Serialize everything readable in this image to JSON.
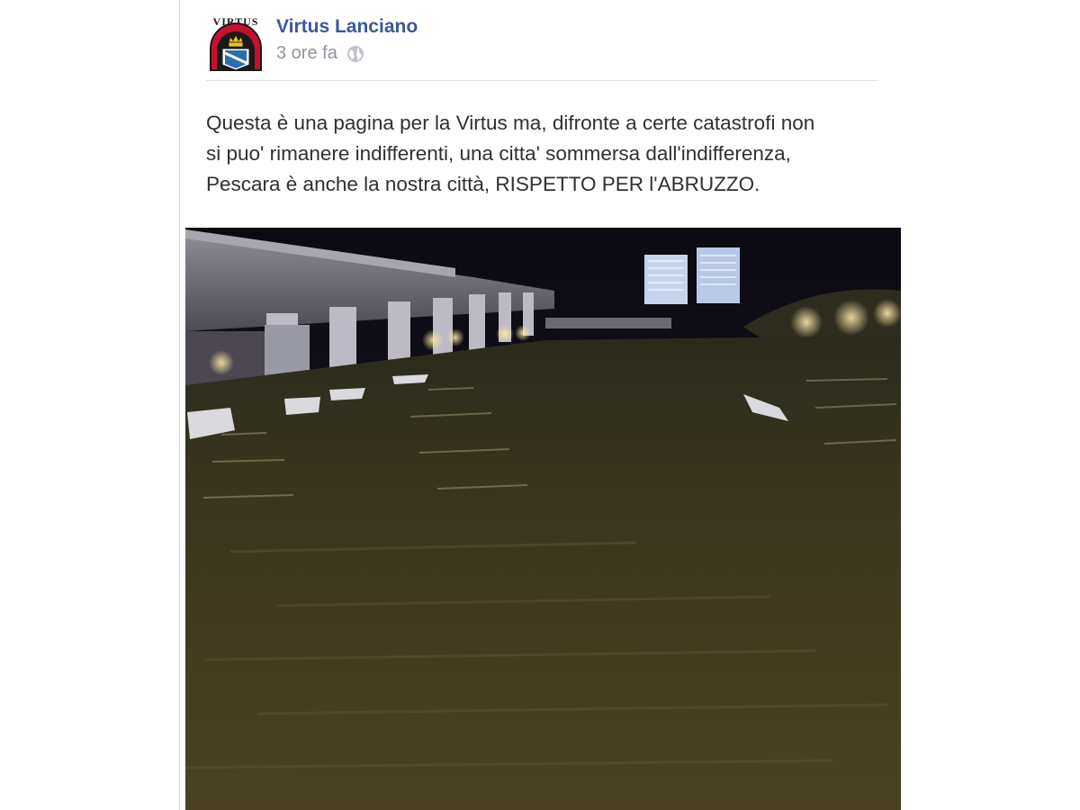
{
  "post": {
    "page_name": "Virtus Lanciano",
    "timestamp": "3 ore fa",
    "privacy_icon": "globe-icon",
    "text_lines": [
      "Questa è una pagina per la Virtus ma, difronte a certe catastrofi non",
      "si puo' rimanere indifferenti, una citta' sommersa dall'indifferenza,",
      "Pescara è anche la nostra città, RISPETTO PER l'ABRUZZO."
    ],
    "avatar": {
      "icon": "virtus-crest-icon",
      "logo_text": "VIRTUS"
    },
    "photo": {
      "description_icon": "flooded-river-photo"
    }
  },
  "colors": {
    "link": "#3b5998",
    "meta": "#90949c",
    "body_text": "#2f3035",
    "crest_red": "#c8102e",
    "crest_blue": "#2a6fb0"
  }
}
